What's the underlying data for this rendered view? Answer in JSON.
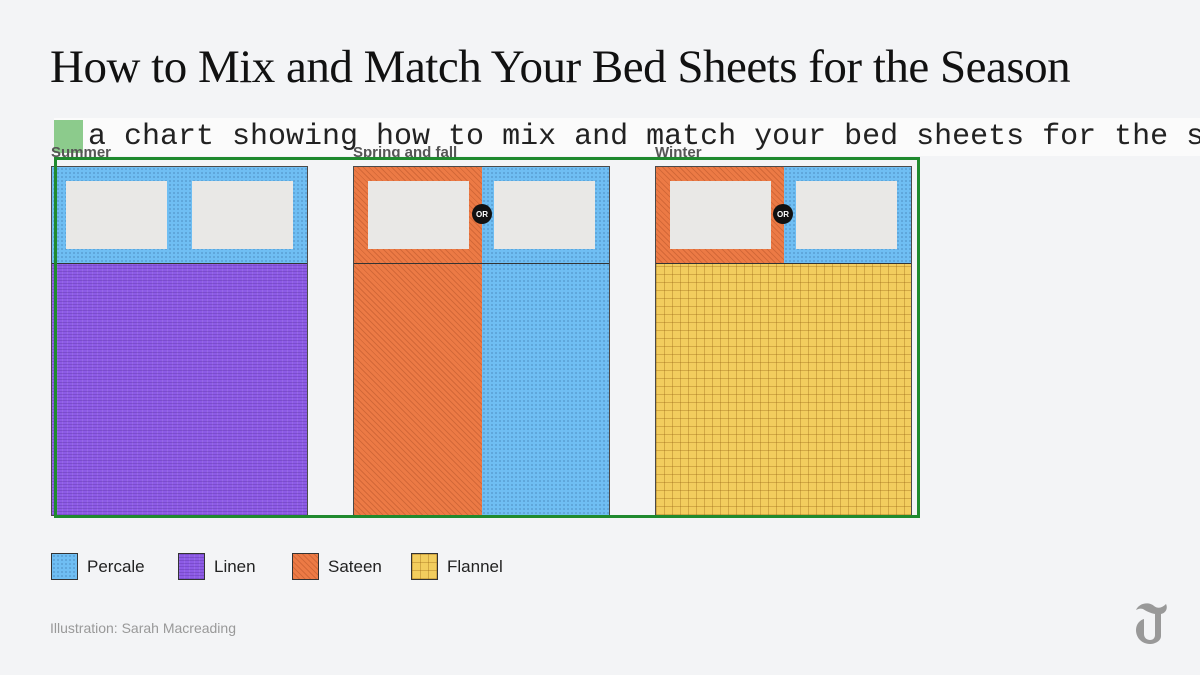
{
  "title": "How to Mix and Match Your Bed Sheets for the Season",
  "caption": "a chart showing how to mix and match your bed sheets for the season",
  "seasons": [
    {
      "label": "Summer",
      "pillows": "Percale",
      "sheets": [
        "Linen"
      ],
      "or": false
    },
    {
      "label": "Spring and fall",
      "pillows": [
        "Sateen",
        "Percale"
      ],
      "sheets": [
        "Sateen",
        "Percale"
      ],
      "or": true,
      "or_label": "OR"
    },
    {
      "label": "Winter",
      "pillows": [
        "Sateen",
        "Percale"
      ],
      "sheets": [
        "Flannel"
      ],
      "or": true,
      "or_label": "OR"
    }
  ],
  "legend": [
    {
      "label": "Percale",
      "color": "#6fbef3"
    },
    {
      "label": "Linen",
      "color": "#8d5be6"
    },
    {
      "label": "Sateen",
      "color": "#ec7a45"
    },
    {
      "label": "Flannel",
      "color": "#f2cd5e"
    }
  ],
  "credit": "Illustration: Sarah Macreading",
  "logo_icon": "nyt-t-logo"
}
